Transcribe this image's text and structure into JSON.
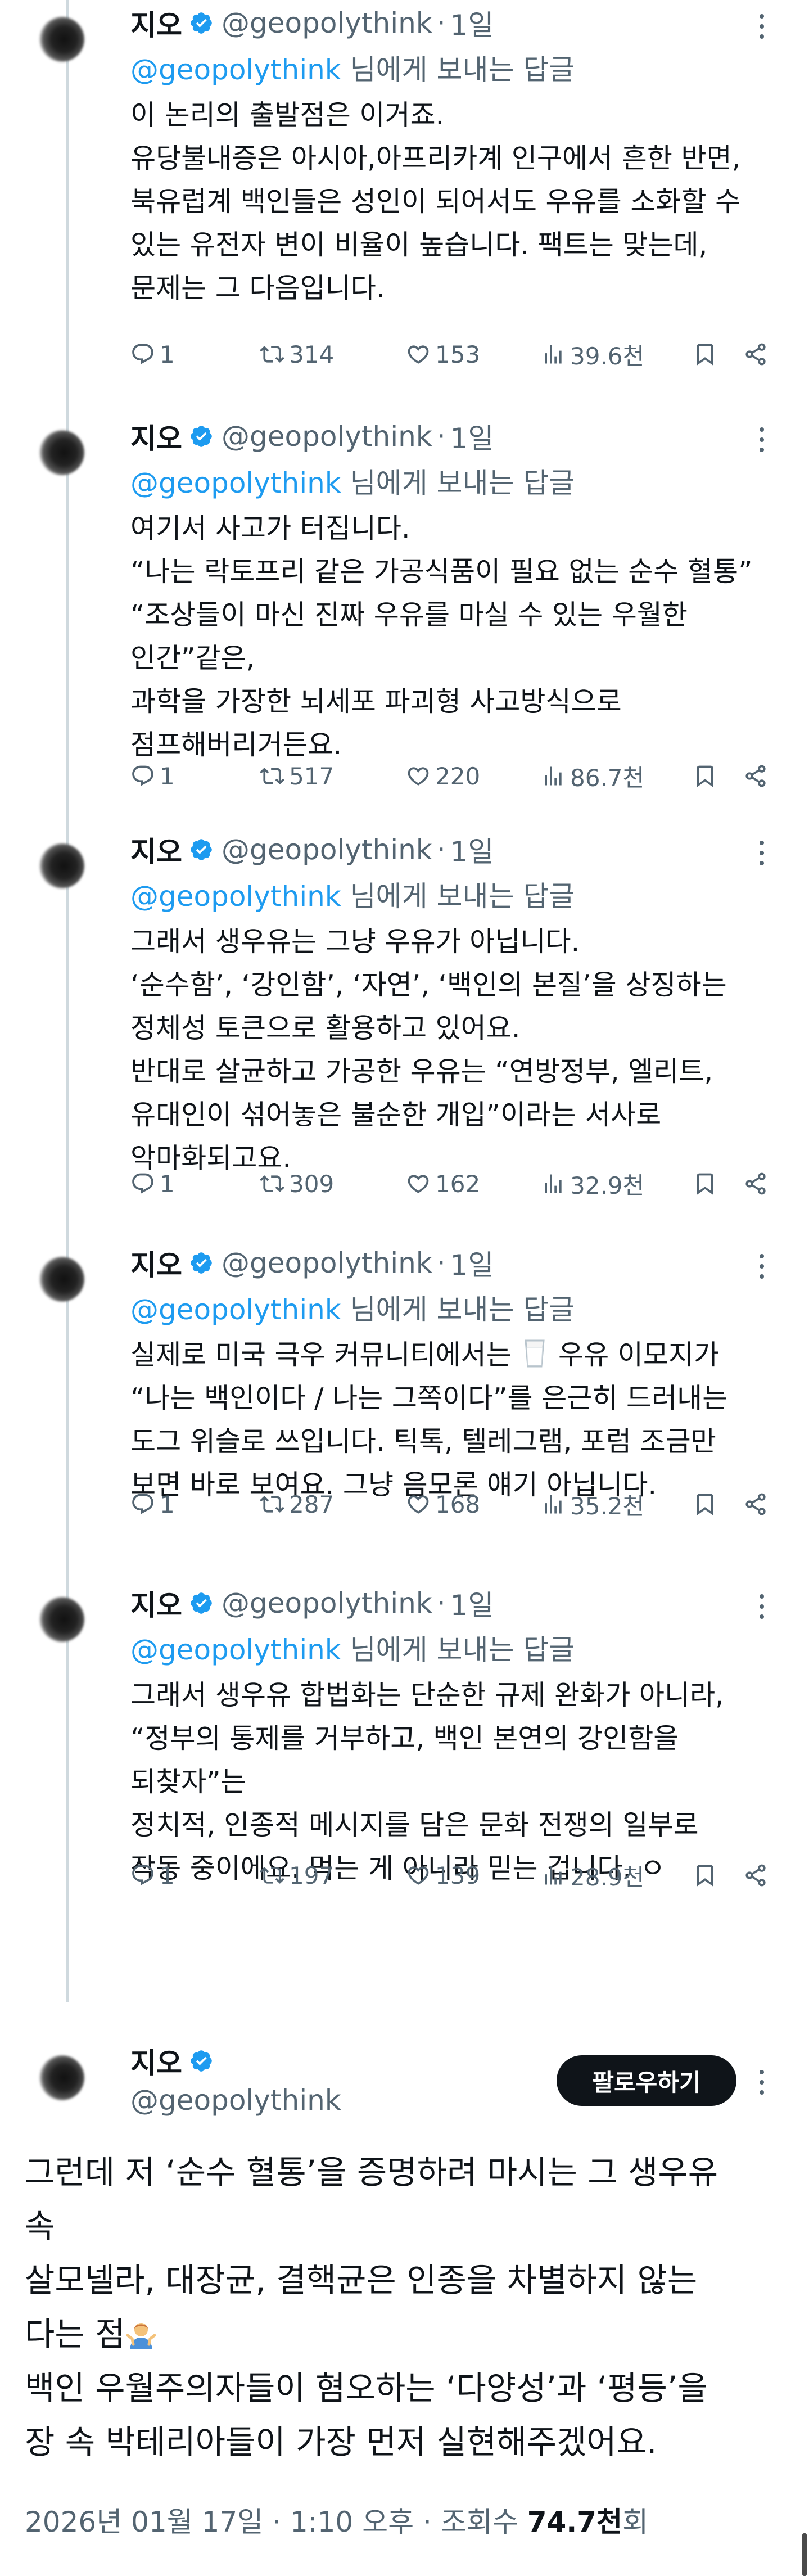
{
  "colors": {
    "accent": "#1d9bf0",
    "text": "#0f1419",
    "muted": "#536471",
    "thread_line": "#cfd9de"
  },
  "replies": [
    {
      "name": "지오",
      "handle": "@geopolythink",
      "separator": "·",
      "time": "1일",
      "reply_to_handle": "@geopolythink",
      "reply_to_suffix": " 님에게 보내는 답글",
      "lines": [
        "이 논리의 출발점은 이거죠.",
        "유당불내증은 아시아,아프리카계 인구에서 흔한 반면,",
        "북유럽계 백인들은 성인이 되어서도 우유를 소화할 수",
        "있는 유전자 변이 비율이 높습니다. 팩트는 맞는데,",
        "문제는 그 다음입니다."
      ],
      "stats": {
        "replies": "1",
        "reposts": "314",
        "likes": "153",
        "views": "39.6천"
      }
    },
    {
      "name": "지오",
      "handle": "@geopolythink",
      "separator": "·",
      "time": "1일",
      "reply_to_handle": "@geopolythink",
      "reply_to_suffix": " 님에게 보내는 답글",
      "lines": [
        "여기서 사고가 터집니다.",
        "“나는 락토프리 같은 가공식품이 필요 없는 순수 혈통”",
        "“조상들이 마신 진짜 우유를 마실 수 있는 우월한",
        "인간”같은,",
        "과학을 가장한 뇌세포 파괴형 사고방식으로",
        "점프해버리거든요."
      ],
      "stats": {
        "replies": "1",
        "reposts": "517",
        "likes": "220",
        "views": "86.7천"
      }
    },
    {
      "name": "지오",
      "handle": "@geopolythink",
      "separator": "·",
      "time": "1일",
      "reply_to_handle": "@geopolythink",
      "reply_to_suffix": " 님에게 보내는 답글",
      "lines": [
        "그래서 생우유는 그냥 우유가 아닙니다.",
        "‘순수함’, ‘강인함’, ‘자연’, ‘백인의 본질’을 상징하는",
        "정체성 토큰으로 활용하고 있어요.",
        "반대로 살균하고 가공한 우유는 “연방정부, 엘리트,",
        "유대인이 섞어놓은 불순한 개입”이라는 서사로",
        "악마화되고요."
      ],
      "stats": {
        "replies": "1",
        "reposts": "309",
        "likes": "162",
        "views": "32.9천"
      }
    },
    {
      "name": "지오",
      "handle": "@geopolythink",
      "separator": "·",
      "time": "1일",
      "reply_to_handle": "@geopolythink",
      "reply_to_suffix": " 님에게 보내는 답글",
      "lines": [
        "실제로 미국 극우 커뮤니티에서는 🥛 우유 이모지가",
        "“나는 백인이다 / 나는 그쪽이다”를 은근히 드러내는",
        "도그 위슬로 쓰입니다. 틱톡, 텔레그램, 포럼 조금만",
        "보면 바로 보여요. 그냥 음모론 얘기 아닙니다."
      ],
      "stats": {
        "replies": "1",
        "reposts": "287",
        "likes": "168",
        "views": "35.2천"
      }
    },
    {
      "name": "지오",
      "handle": "@geopolythink",
      "separator": "·",
      "time": "1일",
      "reply_to_handle": "@geopolythink",
      "reply_to_suffix": " 님에게 보내는 답글",
      "lines": [
        "그래서 생우유 합법화는 단순한 규제 완화가 아니라,",
        "“정부의 통제를 거부하고, 백인 본연의 강인함을",
        "되찾자”는",
        "정치적, 인종적 메시지를 담은 문화 전쟁의 일부로",
        "작동 중이에요. 먹는 게 아니라 믿는 겁니다. ㅇ"
      ],
      "stats": {
        "replies": "1",
        "reposts": "197",
        "likes": "139",
        "views": "28.9천"
      }
    }
  ],
  "main_post": {
    "name": "지오",
    "handle": "@geopolythink",
    "follow_label": "팔로우하기",
    "lines": [
      "그런데 저 ‘순수 혈통’을 증명하려 마시는 그 생우유",
      "속",
      "살모넬라, 대장균, 결핵균은 인종을 차별하지 않는",
      "다는 점",
      "백인 우월주의자들이 혐오하는 ‘다양성’과 ‘평등’을",
      "장 속 박테리아들이 가장 먼저 실현해주겠어요."
    ],
    "shrug_emoji": "person-shrugging-icon",
    "meta_date": "2026년 01월 17일 · 1:10 오후 · 조회수 ",
    "meta_views": "74.7천",
    "meta_views_suffix": "회"
  }
}
